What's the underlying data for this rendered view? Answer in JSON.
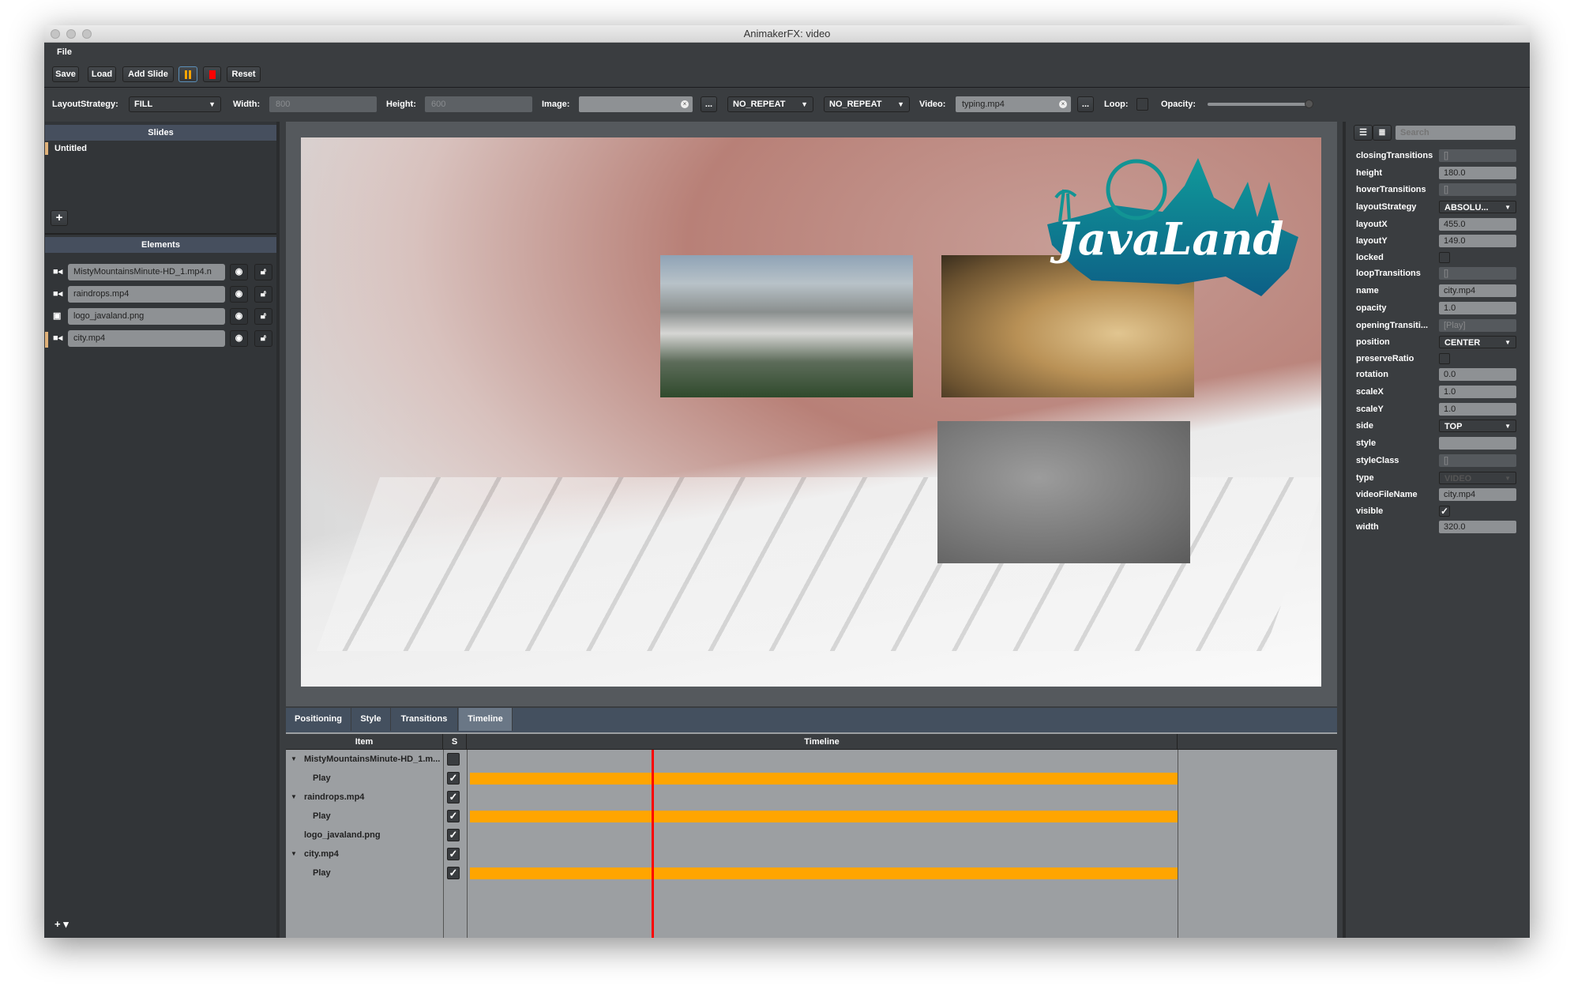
{
  "window": {
    "title": "AnimakerFX: video"
  },
  "menu": {
    "file": "File"
  },
  "toolbar": {
    "save": "Save",
    "load": "Load",
    "add_slide": "Add Slide",
    "pause_icon": "pause-icon",
    "stop_icon": "stop-icon",
    "reset": "Reset",
    "accent": "#ffa500",
    "stop_color": "#ff0000"
  },
  "slide_settings": {
    "layout_strategy_label": "LayoutStrategy:",
    "layout_strategy": "FILL",
    "width_label": "Width:",
    "width": "800",
    "height_label": "Height:",
    "height": "600",
    "image_label": "Image:",
    "image": "",
    "image_browse": "...",
    "repeat_x": "NO_REPEAT",
    "repeat_y": "NO_REPEAT",
    "video_label": "Video:",
    "video": "typing.mp4",
    "video_browse": "...",
    "loop_label": "Loop:",
    "loop": false,
    "opacity_label": "Opacity:",
    "opacity": 1.0
  },
  "slides": {
    "header": "Slides",
    "items": [
      "Untitled"
    ],
    "add": "+"
  },
  "elements": {
    "header": "Elements",
    "items": [
      {
        "name": "MistyMountainsMinute-HD_1.mp4.n",
        "icon": "video-camera-icon"
      },
      {
        "name": "raindrops.mp4",
        "icon": "video-camera-icon"
      },
      {
        "name": "logo_javaland.png",
        "icon": "image-icon"
      },
      {
        "name": "city.mp4",
        "icon": "video-camera-icon",
        "selected": true
      }
    ],
    "add": "+ ▾"
  },
  "canvas": {
    "logo_text": "JavaLand"
  },
  "bottom_tabs": [
    "Positioning",
    "Style",
    "Transitions",
    "Timeline"
  ],
  "timeline": {
    "col_item": "Item",
    "col_s": "S",
    "col_timeline": "Timeline",
    "rows": [
      {
        "name": "MistyMountainsMinute-HD_1.m...",
        "level": 0,
        "expander": "▼",
        "checked": false,
        "bar": false
      },
      {
        "name": "Play",
        "level": 1,
        "checked": true,
        "bar": true
      },
      {
        "name": "raindrops.mp4",
        "level": 0,
        "expander": "▼",
        "checked": true,
        "bar": false
      },
      {
        "name": "Play",
        "level": 1,
        "checked": true,
        "bar": true
      },
      {
        "name": "logo_javaland.png",
        "level": 0,
        "expander": "",
        "checked": true,
        "bar": false
      },
      {
        "name": "city.mp4",
        "level": 0,
        "expander": "▼",
        "checked": true,
        "bar": false
      },
      {
        "name": "Play",
        "level": 1,
        "checked": true,
        "bar": true
      }
    ],
    "bar_color": "#ffa500",
    "playhead_color": "#ff0000"
  },
  "properties": {
    "search_placeholder": "Search",
    "rows": [
      {
        "label": "closingTransitions",
        "value": "[]",
        "kind": "dis"
      },
      {
        "label": "height",
        "value": "180.0"
      },
      {
        "label": "hoverTransitions",
        "value": "[]",
        "kind": "dis"
      },
      {
        "label": "layoutStrategy",
        "value": "ABSOLU...",
        "kind": "cmb"
      },
      {
        "label": "layoutX",
        "value": "455.0"
      },
      {
        "label": "layoutY",
        "value": "149.0"
      },
      {
        "label": "locked",
        "check": false
      },
      {
        "label": "loopTransitions",
        "value": "[]",
        "kind": "dis"
      },
      {
        "label": "name",
        "value": "city.mp4"
      },
      {
        "label": "opacity",
        "value": "1.0"
      },
      {
        "label": "openingTransiti...",
        "value": "[Play]",
        "kind": "dis"
      },
      {
        "label": "position",
        "value": "CENTER",
        "kind": "cmb"
      },
      {
        "label": "preserveRatio",
        "check": false
      },
      {
        "label": "rotation",
        "value": "0.0"
      },
      {
        "label": "scaleX",
        "value": "1.0"
      },
      {
        "label": "scaleY",
        "value": "1.0"
      },
      {
        "label": "side",
        "value": "TOP",
        "kind": "cmb"
      },
      {
        "label": "style",
        "value": ""
      },
      {
        "label": "styleClass",
        "value": "[]",
        "kind": "dis"
      },
      {
        "label": "type",
        "value": "VIDEO",
        "kind": "cmb dis"
      },
      {
        "label": "videoFileName",
        "value": "city.mp4"
      },
      {
        "label": "visible",
        "check": true
      },
      {
        "label": "width",
        "value": "320.0"
      }
    ]
  }
}
